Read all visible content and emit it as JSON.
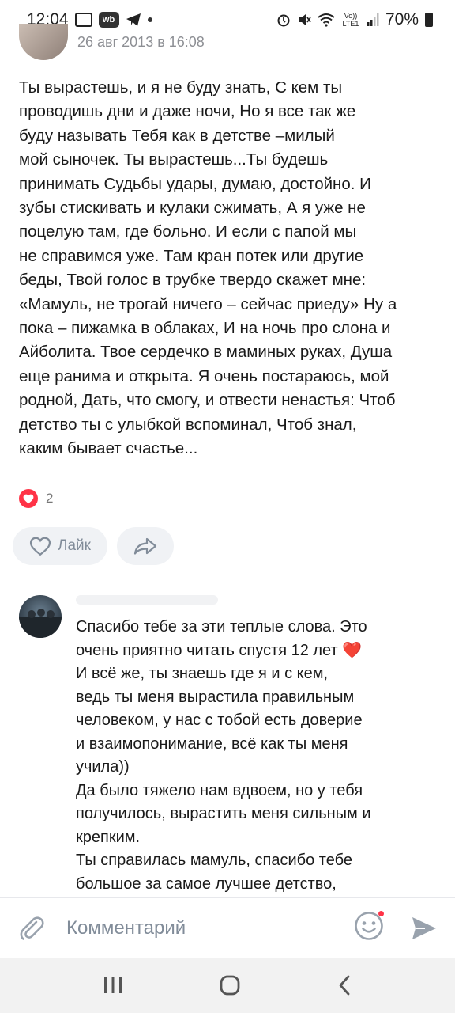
{
  "status_bar": {
    "time": "12:04",
    "wb_label": "wb",
    "battery": "70%",
    "net_label": "Vo)) LTE1"
  },
  "post": {
    "date": "26 авг 2013 в 16:08",
    "text": "Ты вырастешь, и я не буду знать, С кем ты\nпроводишь дни и даже ночи, Но я все так же\nбуду называть Тебя как в детстве –милый\nмой сыночек. Ты вырастешь...Ты будешь\nпринимать Судьбы удары, думаю, достойно. И\nзубы стискивать и кулаки сжимать, А я уже не\nпоцелую там, где больно. И если с папой мы\nне справимся уже. Там кран потек или другие\nбеды, Твой голос в трубке твердо скажет мне:\n«Мамуль, не трогай ничего – сейчас приеду» Ну а\nпока – пижамка в облаках, И на ночь про слона и\nАйболита. Твое сердечко в маминых руках, Душа\nеще ранима и открыта. Я очень постараюсь, мой\nродной, Дать, что смогу, и отвести ненастья: Чтоб\nдетство ты с улыбкой вспоминал, Чтоб знал,\nкаким бывает счастье...",
    "reaction_count": "2",
    "like_label": "Лайк"
  },
  "comment": {
    "text": "Спасибо тебе за эти теплые слова. Это\nочень приятно читать спустя 12 лет ❤️\nИ всё же, ты знаешь где я и с кем,\nведь ты меня вырастила правильным\nчеловеком, у нас с тобой есть доверие\nи взаимопонимание, всё как ты меня\nучила))\nДа было тяжело нам вдвоем, но у тебя\nполучилось, вырастить меня сильным и\nкрепким.\nТы справилась мамуль, спасибо тебе\nбольшое за самое лучшее детство,"
  },
  "input": {
    "placeholder": "Комментарий"
  },
  "colors": {
    "accent": "#818c99",
    "heart": "#ff3347",
    "date": "#8d8f94"
  },
  "icons": {
    "attach": "paperclip-icon",
    "emoji": "smile-icon",
    "send": "send-icon",
    "like": "heart-outline-icon",
    "share": "share-arrow-icon"
  }
}
